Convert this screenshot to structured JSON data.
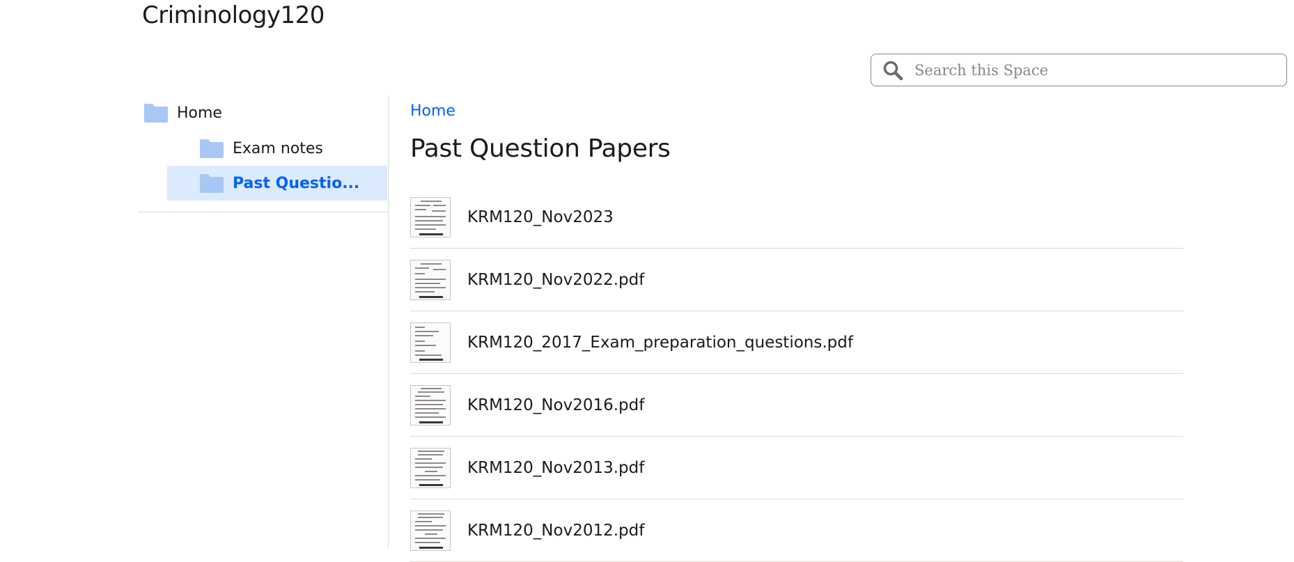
{
  "space": {
    "title": "Criminology120"
  },
  "search": {
    "placeholder": "Search this Space",
    "icon": "search-icon"
  },
  "sidebar": {
    "items": [
      {
        "label": "Home",
        "icon": "folder-icon",
        "selected": false
      },
      {
        "label": "Exam notes",
        "icon": "folder-icon",
        "selected": false
      },
      {
        "label": "Past Questio...",
        "icon": "folder-icon",
        "selected": true
      }
    ]
  },
  "breadcrumb": {
    "home": "Home"
  },
  "page": {
    "title": "Past Question Papers"
  },
  "files": [
    {
      "name": "KRM120_Nov2023"
    },
    {
      "name": "KRM120_Nov2022.pdf"
    },
    {
      "name": "KRM120_2017_Exam_preparation_questions.pdf"
    },
    {
      "name": "KRM120_Nov2016.pdf"
    },
    {
      "name": "KRM120_Nov2013.pdf"
    },
    {
      "name": "KRM120_Nov2012.pdf"
    }
  ],
  "colors": {
    "accent": "#0061fe",
    "selected_bg": "#dceafd",
    "folder": "#a7c8f5",
    "divider": "#dcd8d5",
    "text": "#1e1919"
  }
}
